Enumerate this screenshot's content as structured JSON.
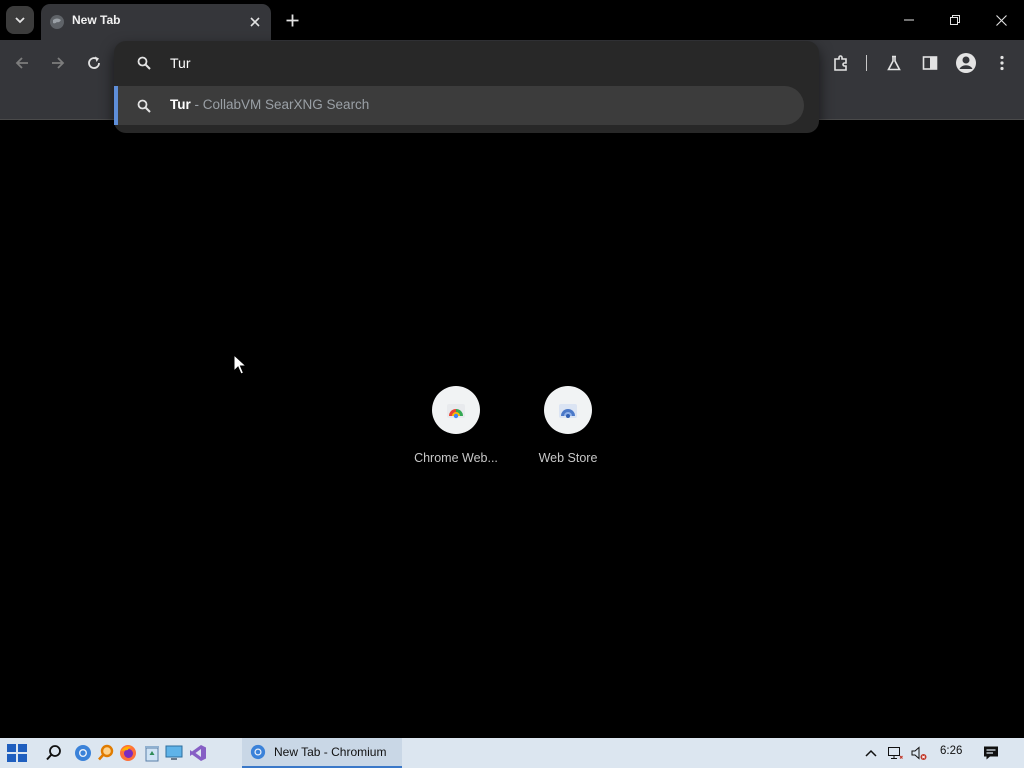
{
  "window": {
    "tab_title": "New Tab",
    "taskbar_title": "New Tab - Chromium"
  },
  "omnibox": {
    "input_text": "Tur",
    "suggestion": {
      "query": "Tur",
      "separator": " - ",
      "engine": "CollabVM SearXNG Search"
    }
  },
  "shortcuts": [
    {
      "label": "Chrome Web...",
      "icon": "chrome-web-store-icon"
    },
    {
      "label": "Web Store",
      "icon": "web-store-icon"
    }
  ],
  "taskbar": {
    "pinned": [
      "start-icon",
      "search-icon",
      "chromium-icon",
      "search-tool-icon",
      "firefox-icon",
      "recycle-bin-icon",
      "computer-icon",
      "visual-studio-icon"
    ],
    "clock": "6:26"
  },
  "colors": {
    "accent": "#5e8ed9",
    "toolbar": "#35363a",
    "background": "#000000",
    "taskbar": "#dce6f0"
  }
}
